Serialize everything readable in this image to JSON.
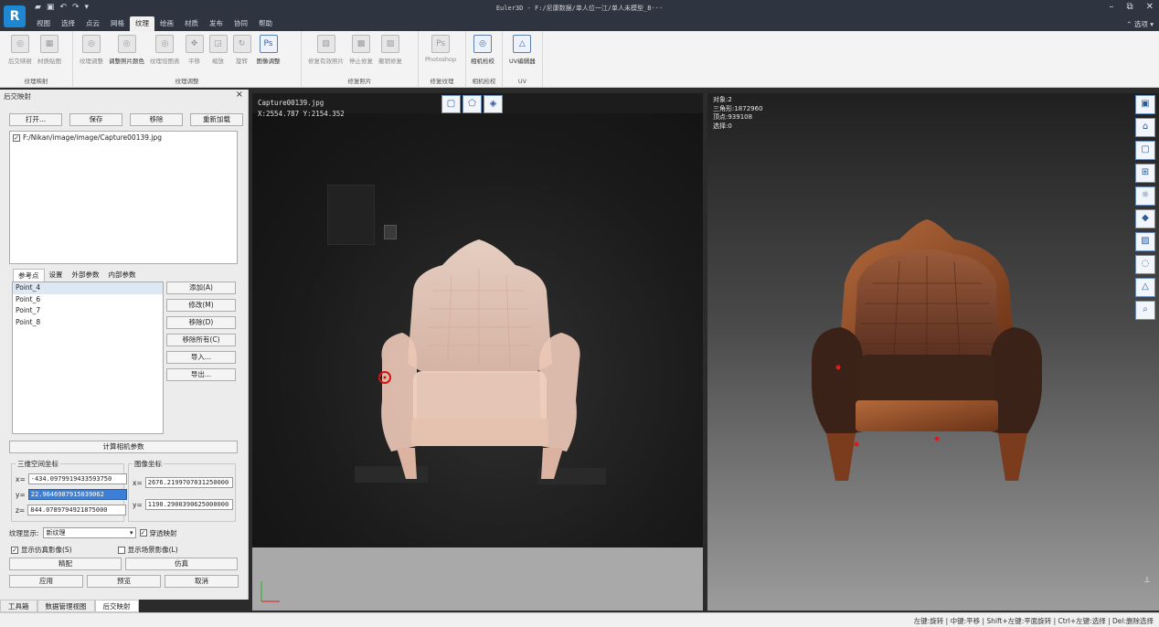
{
  "titlebar": {
    "title": "Euler3D - F:/尼康数据/单人位一江/单人未模型_B···",
    "window_controls": [
      "–",
      "⧉",
      "✕"
    ]
  },
  "menu": {
    "tabs": [
      "视图",
      "选择",
      "点云",
      "网格",
      "纹理",
      "绘画",
      "材质",
      "发布",
      "协同",
      "帮助"
    ],
    "active_tab": "纹理",
    "options": "⌃ 选项 ▾"
  },
  "ribbon": {
    "groups": [
      {
        "name": "纹理映射",
        "buttons": [
          "后交映射",
          "材质贴图"
        ]
      },
      {
        "name": "纹理调整",
        "buttons": [
          "纹理调整",
          "调整照片颜色",
          "纹理坦图表",
          "平移",
          "缩放",
          "旋转",
          "图像调整"
        ]
      },
      {
        "name": "修复照片",
        "buttons": [
          "修复有效照片",
          "停止修复",
          "撤销修复"
        ]
      },
      {
        "name": "修复纹理",
        "buttons": [
          "Photoshop"
        ]
      },
      {
        "name": "相机检校",
        "buttons": [
          "相机检校"
        ]
      },
      {
        "name": "UV",
        "buttons": [
          "UV编辑器"
        ]
      }
    ]
  },
  "left_panel": {
    "title": "后交映射",
    "top_buttons": [
      "打开...",
      "保存",
      "移除",
      "重新加载"
    ],
    "file_path": "F:/Nikan/image/image/Capture00139.jpg",
    "subtabs": [
      "参考点",
      "设置",
      "外部参数",
      "内部参数"
    ],
    "points": [
      "Point_4",
      "Point_6",
      "Point_7",
      "Point_8"
    ],
    "point_buttons": [
      "添加(A)",
      "修改(M)",
      "移除(D)",
      "移除所有(C)",
      "导入...",
      "导出..."
    ],
    "calc_button": "计算相机参数",
    "coord3d": {
      "title": "三维空间坐标",
      "x_label": "x=",
      "x": "-434.0979919433593750",
      "y_label": "y=",
      "y": "22.9646987915039062",
      "z_label": "z=",
      "z": "844.0789794921875000"
    },
    "coord2d": {
      "title": "图像坐标",
      "x_label": "x=",
      "x": "2676.2199707031250000",
      "y_label": "y=",
      "y": "1190.2900390625000000"
    },
    "texture_label": "纹理显示:",
    "texture_value": "新纹理",
    "through_map": "穿透映射",
    "show_sim": "显示仿真影像(S)",
    "show_scene": "显示场景影像(L)",
    "btn_match": "精配",
    "btn_sim": "仿真",
    "btn_apply": "应用",
    "btn_preview": "预览",
    "btn_cancel": "取消"
  },
  "bottom_tabs": [
    "工具箱",
    "数据管理视图",
    "后交映射"
  ],
  "viewport_image": {
    "filename": "Capture00139.jpg",
    "coords": "X:2554.787 Y:2154.352"
  },
  "viewport_model": {
    "stats": [
      "对象:2",
      "三角形:1872960",
      "顶点:939108",
      "选择:0"
    ]
  },
  "statusbar": {
    "text": "左键:旋转 | 中键:平移 | Shift+左键:平面旋转 | Ctrl+左键:选择 | Del:删除选择"
  },
  "colors": {
    "accent": "#1f86d1",
    "chrome_dark": "#2e3440",
    "selection": "#3d7fd6"
  }
}
